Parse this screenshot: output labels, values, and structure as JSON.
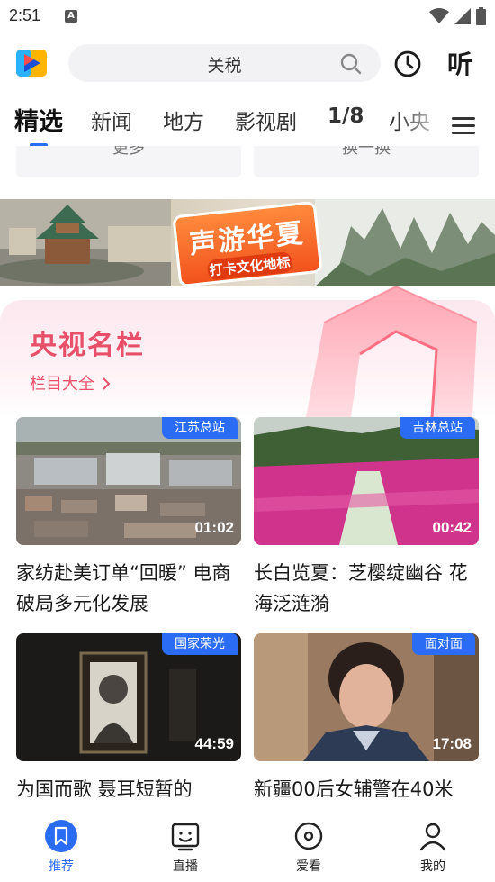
{
  "status_bar": {
    "time": "2:51",
    "notification_letter": "A"
  },
  "header": {
    "search_text": "关税",
    "listen_label": "听"
  },
  "tabs": [
    "精选",
    "新闻",
    "地方",
    "影视剧",
    "1/8",
    "小央"
  ],
  "partial_cards": [
    "更多",
    "换一换"
  ],
  "banner": {
    "title": "声游华夏",
    "subtitle": "打卡文化地标"
  },
  "section": {
    "title": "央视名栏",
    "link": "栏目大全"
  },
  "videos": [
    {
      "tag": "江苏总站",
      "duration": "01:02",
      "title": "家纺赴美订单“回暖” 电商破局多元化发展"
    },
    {
      "tag": "吉林总站",
      "duration": "00:42",
      "title": "长白览夏：芝樱绽幽谷 花海泛涟漪"
    },
    {
      "tag": "国家荣光",
      "duration": "44:59",
      "title": "为国而歌 聂耳短暂的"
    },
    {
      "tag": "面对面",
      "duration": "17:08",
      "title": "新疆00后女辅警在40米"
    }
  ],
  "bottom_nav": [
    {
      "label": "推荐",
      "icon": "bookmark-icon",
      "active": true
    },
    {
      "label": "直播",
      "icon": "tv-face-icon",
      "active": false
    },
    {
      "label": "爱看",
      "icon": "disc-icon",
      "active": false
    },
    {
      "label": "我的",
      "icon": "person-icon",
      "active": false
    }
  ],
  "colors": {
    "accent": "#2b6cf5",
    "section": "#e8506a"
  }
}
